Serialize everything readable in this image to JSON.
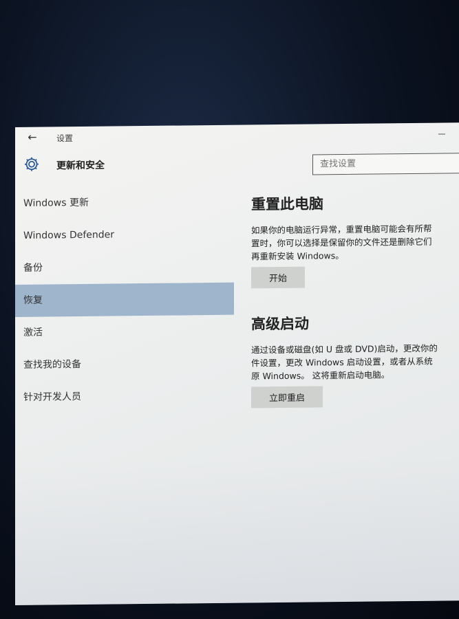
{
  "window": {
    "title": "设置",
    "back_glyph": "←"
  },
  "header": {
    "icon": "gear-icon",
    "title": "更新和安全"
  },
  "search": {
    "placeholder": "查找设置"
  },
  "sidebar": {
    "items": [
      {
        "label": "Windows 更新"
      },
      {
        "label": "Windows Defender"
      },
      {
        "label": "备份"
      },
      {
        "label": "恢复"
      },
      {
        "label": "激活"
      },
      {
        "label": "查找我的设备"
      },
      {
        "label": "针对开发人员"
      }
    ],
    "active_index": 3
  },
  "sections": {
    "reset": {
      "title": "重置此电脑",
      "lines": [
        "如果你的电脑运行异常，重置电脑可能会有所帮",
        "置时，你可以选择是保留你的文件还是删除它们",
        "再重新安装 Windows。"
      ],
      "button": "开始"
    },
    "advanced": {
      "title": "高级启动",
      "lines": [
        "通过设备或磁盘(如 U 盘或 DVD)启动，更改你的",
        "件设置，更改 Windows 启动设置，或者从系统",
        "原 Windows。  这将重新启动电脑。"
      ],
      "button": "立即重启"
    }
  },
  "colors": {
    "active_nav": "#9fb5cc",
    "button_bg": "#cfd1cf",
    "window_bg": "#eeeeee"
  }
}
